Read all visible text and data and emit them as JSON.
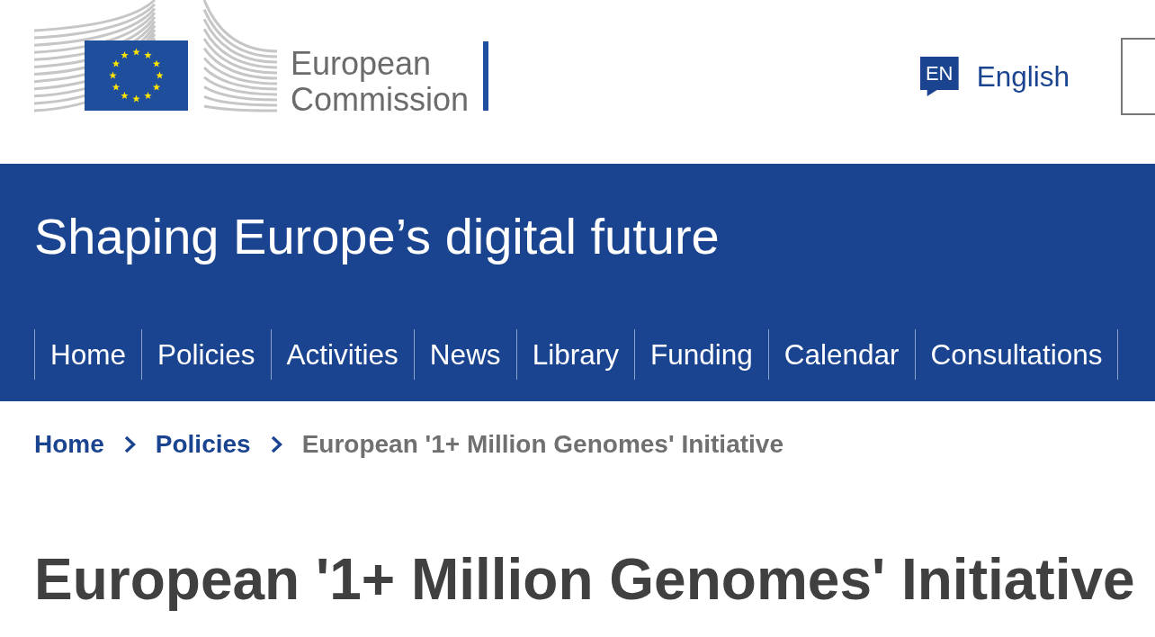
{
  "header": {
    "logo_text": [
      "European",
      "Commission"
    ],
    "language": {
      "code": "EN",
      "label": "English"
    }
  },
  "site": {
    "title": "Shaping Europe’s digital future"
  },
  "nav": {
    "items": [
      {
        "label": "Home"
      },
      {
        "label": "Policies"
      },
      {
        "label": "Activities"
      },
      {
        "label": "News"
      },
      {
        "label": "Library"
      },
      {
        "label": "Funding"
      },
      {
        "label": "Calendar"
      },
      {
        "label": "Consultations"
      }
    ]
  },
  "breadcrumb": {
    "items": [
      {
        "label": "Home",
        "kind": "link"
      },
      {
        "label": "Policies",
        "kind": "link"
      },
      {
        "label": "European '1+ Million Genomes' Initiative",
        "kind": "current"
      }
    ]
  },
  "page": {
    "title": "European '1+ Million Genomes' Initiative"
  }
}
